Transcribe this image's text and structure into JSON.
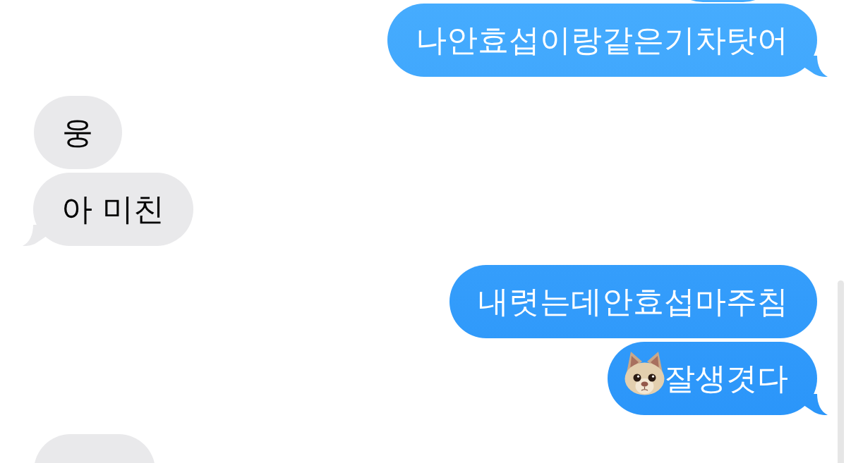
{
  "messages": [
    {
      "sent": true,
      "kind": "clipped"
    },
    {
      "sent": true,
      "kind": "text",
      "text": "나안효섭이랑같은기차탓어",
      "tail": true
    },
    {
      "sent": false,
      "kind": "text",
      "text": "웅",
      "tail": false
    },
    {
      "sent": false,
      "kind": "text",
      "text": "아 미친",
      "tail": true
    },
    {
      "sent": true,
      "kind": "text",
      "text": "내렷는데안효섭마주침",
      "tail": false
    },
    {
      "sent": true,
      "kind": "sticker_text",
      "text": "잘생겻다",
      "tail": true
    },
    {
      "sent": false,
      "kind": "clipped"
    }
  ]
}
